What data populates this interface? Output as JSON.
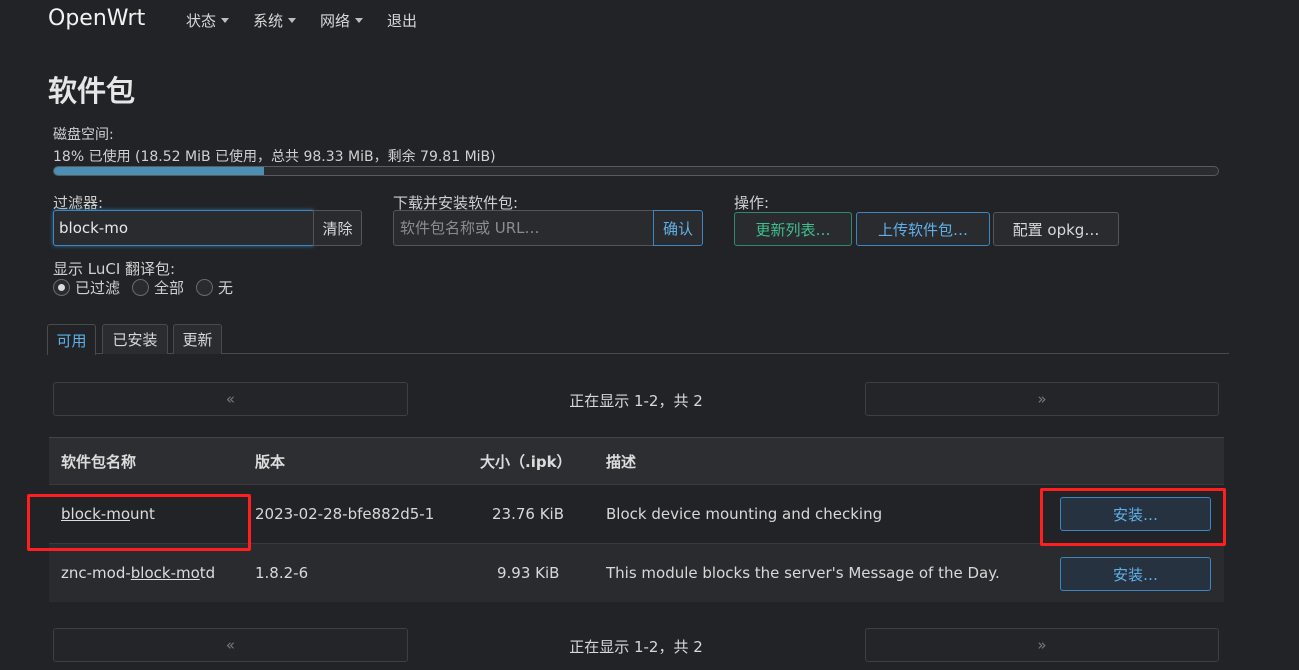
{
  "brand": "OpenWrt",
  "nav": [
    "状态",
    "系统",
    "网络",
    "退出"
  ],
  "page_title": "软件包",
  "disk": {
    "label": "磁盘空间:",
    "usage_text": "18% 已使用 (18.52 MiB 已使用，总共 98.33 MiB，剩余 79.81 MiB)",
    "percent_used": 18
  },
  "filter": {
    "label": "过滤器:",
    "value": "block-mo",
    "clear_label": "清除"
  },
  "download": {
    "label": "下载并安装软件包:",
    "placeholder": "软件包名称或 URL…",
    "confirm_label": "确认"
  },
  "actions": {
    "label": "操作:",
    "update_lists": "更新列表…",
    "upload_package": "上传软件包…",
    "configure_opkg": "配置 opkg…"
  },
  "luci_i18n": {
    "label": "显示 LuCI 翻译包:",
    "options": [
      "已过滤",
      "全部",
      "无"
    ],
    "selected": "已过滤"
  },
  "tabs": [
    "可用",
    "已安装",
    "更新"
  ],
  "active_tab": "可用",
  "pager": {
    "prev": "«",
    "next": "»",
    "status": "正在显示 1-2，共 2"
  },
  "table": {
    "headers": [
      "软件包名称",
      "版本",
      "大小（.ipk）",
      "描述"
    ],
    "rows": [
      {
        "name_pre": "",
        "name_match": "block-mo",
        "name_post": "unt",
        "version": "2023-02-28-bfe882d5-1",
        "size": "23.76 KiB",
        "description": "Block device mounting and checking",
        "action": "安装…"
      },
      {
        "name_pre": "znc-mod-",
        "name_match": "block-mo",
        "name_post": "td",
        "version": "1.8.2-6",
        "size": "9.93 KiB",
        "description": "This module blocks the server's Message of the Day.",
        "action": "安装…"
      }
    ]
  },
  "colors": {
    "accent_blue": "#5fb0e8",
    "accent_green": "#3fbf8f",
    "highlight_red": "#ff1f1f",
    "background": "#222326"
  }
}
